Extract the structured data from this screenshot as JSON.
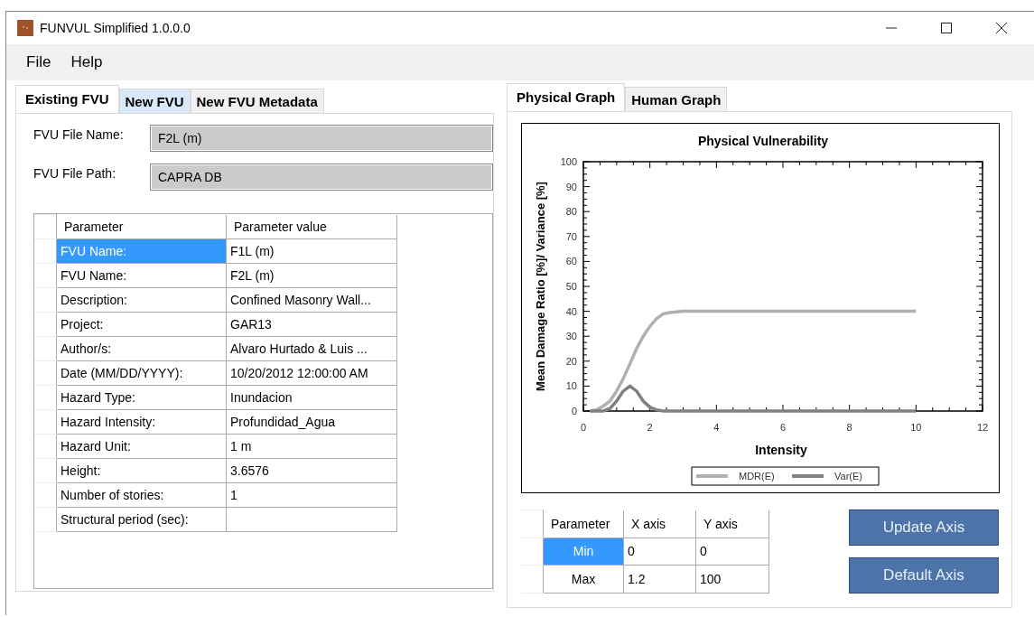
{
  "window": {
    "title": "FUNVUL Simplified 1.0.0.0"
  },
  "menu": [
    "File",
    "Help"
  ],
  "left_tabs": [
    {
      "label": "Existing FVU",
      "selected": true
    },
    {
      "label": "New FVU",
      "selected": false
    },
    {
      "label": "New FVU Metadata",
      "selected": false
    }
  ],
  "fields": [
    {
      "label": "FVU File Name:",
      "value": "F2L (m)"
    },
    {
      "label": "FVU File Path:",
      "value": "CAPRA DB"
    }
  ],
  "parameter_table": {
    "columns": [
      "Parameter",
      "Parameter value"
    ],
    "rows": [
      {
        "cells": [
          "FVU Name:",
          "F1L (m)"
        ],
        "selected": true
      },
      {
        "cells": [
          "FVU Name:",
          "F2L (m)"
        ],
        "selected": false
      },
      {
        "cells": [
          "Description:",
          "Confined Masonry Wall..."
        ],
        "selected": false
      },
      {
        "cells": [
          "Project:",
          " GAR13"
        ],
        "selected": false
      },
      {
        "cells": [
          "Author/s:",
          " Alvaro Hurtado & Luis ..."
        ],
        "selected": false
      },
      {
        "cells": [
          "Date (MM/DD/YYYY):",
          "10/20/2012 12:00:00 AM"
        ],
        "selected": false
      },
      {
        "cells": [
          "Hazard Type:",
          "Inundacion"
        ],
        "selected": false
      },
      {
        "cells": [
          "Hazard Intensity:",
          "Profundidad_Agua"
        ],
        "selected": false
      },
      {
        "cells": [
          "Hazard Unit:",
          " 1 m"
        ],
        "selected": false
      },
      {
        "cells": [
          "Height:",
          "3.6576"
        ],
        "selected": false
      },
      {
        "cells": [
          "Number of stories:",
          "1"
        ],
        "selected": false
      },
      {
        "cells": [
          "Structural period (sec):",
          ""
        ],
        "selected": false
      }
    ]
  },
  "right_tabs": [
    {
      "label": "Physical Graph",
      "selected": true
    },
    {
      "label": "Human Graph",
      "selected": false
    }
  ],
  "chart": {
    "chart_data": {
      "type": "line",
      "title": "Physical Vulnerability",
      "xlabel": "Intensity",
      "ylabel": "Mean Damage Ratio [%]/ Variance [%]",
      "x": [
        0.2,
        0.4,
        0.6,
        0.8,
        1,
        1.2,
        1.4,
        1.6,
        1.8,
        2,
        2.2,
        2.4,
        2.6,
        2.8,
        3,
        4,
        5,
        6,
        7,
        8,
        9,
        10
      ],
      "series": [
        {
          "name": "MDR(E)",
          "color": "#b0b0b0",
          "values": [
            0,
            0.5,
            2,
            4,
            8,
            13,
            19,
            25,
            30,
            34,
            37,
            39,
            39.5,
            39.8,
            40,
            40,
            40,
            40,
            40,
            40,
            40,
            40
          ]
        },
        {
          "name": "Var(E)",
          "color": "#808080",
          "values": [
            0,
            0,
            0,
            1,
            4,
            8,
            10,
            8,
            4,
            1.5,
            0.5,
            0,
            0,
            0,
            0,
            0,
            0,
            0,
            0,
            0,
            0,
            0
          ]
        }
      ],
      "legend": "bottom",
      "xlim": [
        0,
        12
      ],
      "ylim": [
        0,
        100
      ],
      "xticks": [
        0,
        2,
        4,
        6,
        8,
        10,
        12
      ],
      "yticks": [
        0,
        10,
        20,
        30,
        40,
        50,
        60,
        70,
        80,
        90,
        100
      ]
    }
  },
  "axis_table": {
    "columns": [
      "Parameter",
      "X axis",
      "Y axis"
    ],
    "rows": [
      {
        "cells": [
          "Min",
          "0",
          "0"
        ],
        "selected": true
      },
      {
        "cells": [
          "Max",
          "1.2",
          "100"
        ],
        "selected": false
      }
    ]
  },
  "buttons": [
    "Update Axis",
    "Default Axis"
  ]
}
